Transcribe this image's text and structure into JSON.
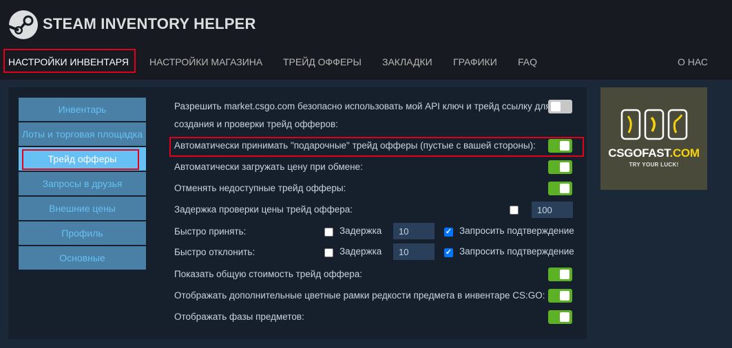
{
  "app": {
    "title": "STEAM INVENTORY HELPER"
  },
  "nav": {
    "items": [
      {
        "label": "НАСТРОЙКИ ИНВЕНТАРЯ",
        "active": true
      },
      {
        "label": "НАСТРОЙКИ МАГАЗИНА"
      },
      {
        "label": "ТРЕЙД ОФФЕРЫ"
      },
      {
        "label": "ЗАКЛАДКИ"
      },
      {
        "label": "ГРАФИКИ"
      },
      {
        "label": "FAQ"
      },
      {
        "label": "О НАС"
      }
    ]
  },
  "sidebar": {
    "items": [
      {
        "label": "Инвентарь"
      },
      {
        "label": "Лоты и торговая площадка"
      },
      {
        "label": "Трейд офферы",
        "active": true
      },
      {
        "label": "Запросы в друзья"
      },
      {
        "label": "Внешние цены"
      },
      {
        "label": "Профиль"
      },
      {
        "label": "Основные"
      }
    ]
  },
  "settings": {
    "api_line1": "Разрешить market.csgo.com безопасно использовать мой API ключ и трейд ссылку для",
    "api_line2": "создания и проверки трейд офферов:",
    "api_toggle": false,
    "accept_gift": "Автоматически принимать \"подарочные\" трейд офферы (пустые с вашей стороны):",
    "accept_gift_toggle": true,
    "load_price": "Автоматически загружать цену при обмене:",
    "load_price_toggle": true,
    "cancel_unavailable": "Отменять недоступные трейд офферы:",
    "cancel_unavailable_toggle": true,
    "price_check_delay": "Задержка проверки цены трейд оффера:",
    "price_check_delay_checked": false,
    "price_check_delay_value": "100",
    "quick_accept": "Быстро принять:",
    "quick_decline": "Быстро отклонить:",
    "delay_label": "Задержка",
    "confirm_label": "Запросить подтверждение",
    "quick_accept_delay_checked": false,
    "quick_accept_delay_value": "10",
    "quick_accept_confirm_checked": true,
    "quick_decline_delay_checked": false,
    "quick_decline_delay_value": "10",
    "quick_decline_confirm_checked": true,
    "show_total": "Показать общую стоимость трейд оффера:",
    "show_total_toggle": true,
    "rarity_frames": "Отображать дополнительные цветные рамки редкости предмета в инвентаре CS:GO:",
    "rarity_frames_toggle": true,
    "phases": "Отображать фазы предметов:",
    "phases_toggle": true
  },
  "ad": {
    "brand_main": "CSGOFAST",
    "brand_suffix": ".COM",
    "tagline": "TRY YOUR LUCK!",
    "accent_color": "#f5d20f"
  },
  "colors": {
    "header_bg": "#171a21",
    "page_bg": "#1b2838",
    "toggle_on": "#5cb224",
    "highlight": "#e2001a"
  }
}
